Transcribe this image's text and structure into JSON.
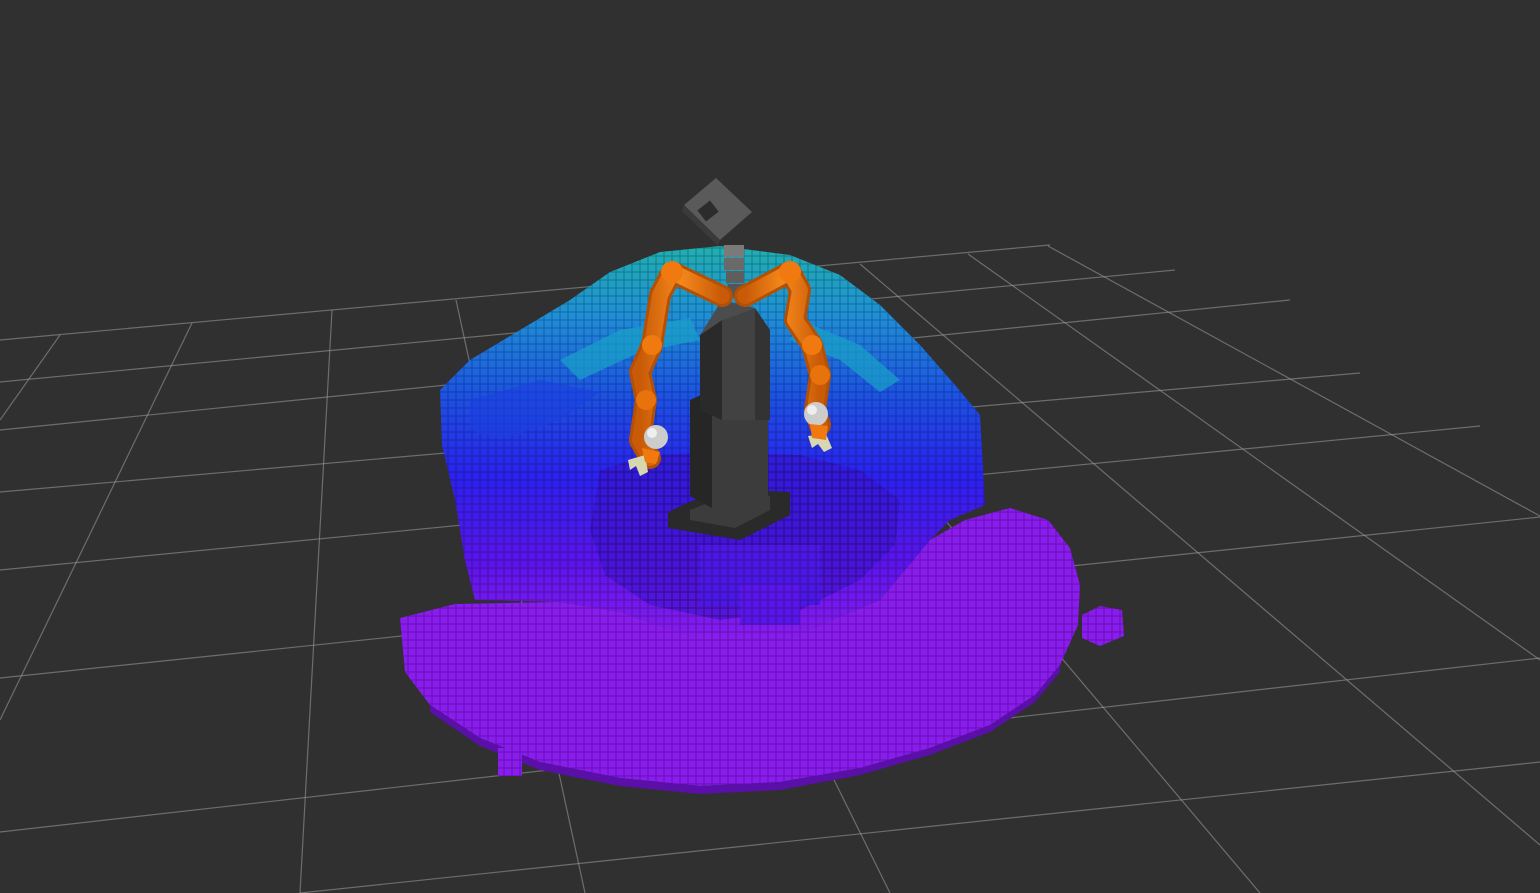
{
  "viewport": {
    "background": "#303030",
    "grid_color": "#a0a0a0"
  },
  "scene": {
    "octomap_palette": [
      "#8a1cf0",
      "#6a16ee",
      "#4d12e6",
      "#2e22f0",
      "#1a3ee8",
      "#1e5ee0",
      "#1e86d8",
      "#1aa2c8",
      "#20b0b0"
    ],
    "robot_colors": {
      "arm": "#f07a10",
      "pillar": "#3a3a3a",
      "head": "#5a5a5a",
      "wrist_sphere": "#cccccc",
      "gripper": "#d8d8b0"
    }
  }
}
